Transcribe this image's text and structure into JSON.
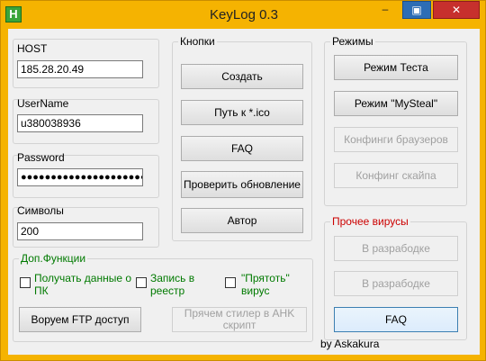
{
  "window": {
    "title": "KeyLog 0.3",
    "icon_letter": "H",
    "minimize_glyph": "–",
    "maximize_glyph": "▣",
    "close_glyph": "✕"
  },
  "connection": {
    "host_label": "HOST",
    "host_value": "185.28.20.49",
    "username_label": "UserName",
    "username_value": "u380038936",
    "password_label": "Password",
    "password_value": "●●●●●●●●●●●●●●●●●●●●●",
    "symbols_label": "Символы",
    "symbols_value": "200"
  },
  "buttons_group": {
    "title": "Кнопки",
    "create": "Создать",
    "icon_path": "Путь к *.ico",
    "faq": "FAQ",
    "check_update": "Проверить обновление",
    "author": "Автор"
  },
  "modes_group": {
    "title": "Режимы",
    "test_mode": "Режим Теста",
    "mysteal_mode": "Режим \"MySteal\"",
    "browser_configs": "Конфинги браузеров",
    "skype_config": "Конфинг скайпа"
  },
  "other_viruses": {
    "title": "Прочее вирусы",
    "in_dev_1": "В разрабодке",
    "in_dev_2": "В разрабодке",
    "faq": "FAQ"
  },
  "extra_functions": {
    "title": "Доп.Функции",
    "get_pc_data": "Получать данные о ПК",
    "registry_write": "Запись в реестр",
    "hide_virus": "\"Прятоть\" вирус",
    "ftp_button": "Воруем FTP доступ",
    "ahk_button": "Прячем стилер в AHK скрипт"
  },
  "footer": {
    "credit": "by Askakura"
  }
}
